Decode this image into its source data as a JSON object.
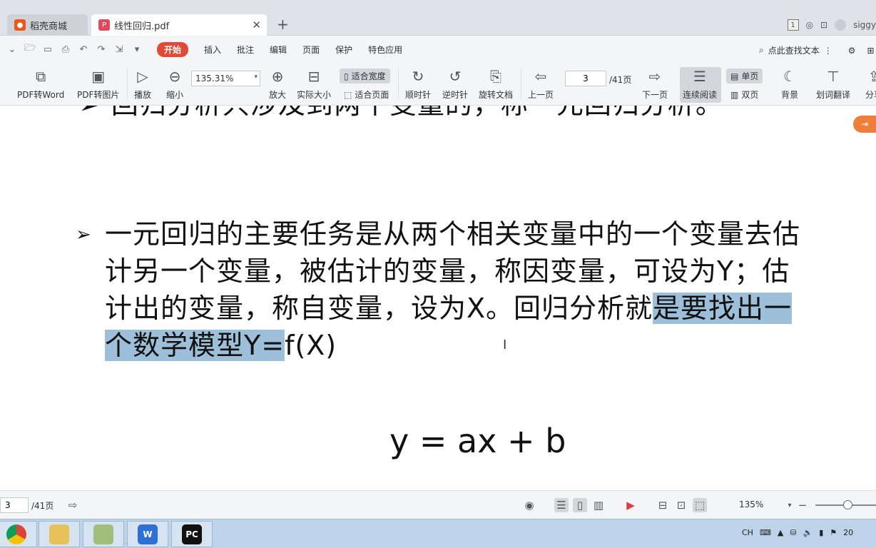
{
  "tabs": [
    {
      "label": "稻壳商城",
      "icon_color": "#e8581e"
    },
    {
      "label": "线性回归.pdf",
      "icon_color": "#e04a5a"
    }
  ],
  "window": {
    "user_label": "siggy",
    "badge": "1"
  },
  "menu": {
    "items": [
      "开始",
      "插入",
      "批注",
      "编辑",
      "页面",
      "保护",
      "特色应用"
    ],
    "search_label": "点此查找文本"
  },
  "toolbar": {
    "pdf_to_word": "PDF转Word",
    "pdf_to_image": "PDF转图片",
    "play": "播放",
    "zoom_out": "缩小",
    "zoom_value": "135.31%",
    "zoom_in": "放大",
    "actual_size": "实际大小",
    "fit_width": "适合宽度",
    "fit_page": "适合页面",
    "rotate_cw": "顺时针",
    "rotate_ccw": "逆时针",
    "rotate_doc": "旋转文档",
    "prev_page": "上一页",
    "page_current": "3",
    "page_total": "/41页",
    "next_page": "下一页",
    "continuous": "连续阅读",
    "single": "单页",
    "double": "双页",
    "background": "背景",
    "translate": "划词翻译",
    "share": "分享"
  },
  "document": {
    "cut_line": "回归分析只涉及到两个变量的，称一元回归分析。",
    "para_plain": "一元回归的主要任务是从两个相关变量中的一个变量去估计另一个变量，被估计的变量，称因变量，可设为Y；估计出的变量，称自变量，设为X。回归分析就",
    "para_highlight": "是要找出一个数学模型Y=",
    "para_tail": "f(X)",
    "formula": "y = ax + b",
    "bullet": "➢"
  },
  "statusbar": {
    "page_current": "3",
    "page_total": "/41页",
    "zoom": "135%"
  },
  "taskbar": {
    "apps": [
      "chrome",
      "file-explorer",
      "notes",
      "wps",
      "pycharm"
    ],
    "pycharm_label": "PC",
    "tray_lang": "CH",
    "clock_fragment": "20"
  },
  "colors": {
    "accent": "#e04a36",
    "highlight": "#9dbfda",
    "taskbar": "#bcd3ea"
  }
}
